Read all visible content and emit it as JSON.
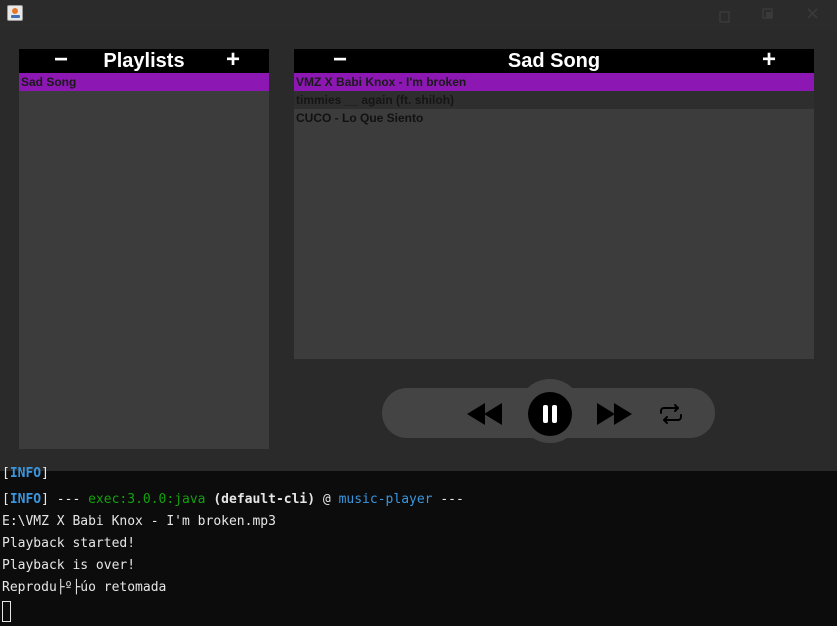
{
  "titlebar": {
    "icon": "java-coffee-icon",
    "controls": [
      "minimize-icon",
      "maximize-icon",
      "close-icon"
    ]
  },
  "playlists_panel": {
    "title": "Playlists",
    "remove_label": "−",
    "add_label": "+",
    "items": [
      {
        "label": "Sad Song",
        "selected": true
      }
    ]
  },
  "songs_panel": {
    "title": "Sad Song",
    "remove_label": "−",
    "add_label": "+",
    "items": [
      {
        "label": "VMZ X Babi Knox - I'm broken",
        "selected": true
      },
      {
        "label": "timmies __ again (ft. shiloh)",
        "selected": false
      },
      {
        "label": "CUCO - Lo Que Siento",
        "selected": false
      }
    ]
  },
  "player_controls": {
    "buttons": [
      "rewind-icon",
      "pause-icon",
      "fast-forward-icon",
      "repeat-icon"
    ]
  },
  "console": {
    "line0": {
      "tag": "INFO"
    },
    "line1": {
      "tag": "INFO",
      "sep1": " --- ",
      "plugin": "exec:3.0.0:java",
      "sp": " ",
      "execution": "(default-cli)",
      "at": " @ ",
      "project": "music-player",
      "sep2": " ---"
    },
    "line2": "E:\\VMZ X Babi Knox - I'm broken.mp3",
    "line3": "Playback started!",
    "line4": "Playback is over!",
    "line5": "Reprodu├º├úo retomada"
  },
  "colors": {
    "selection": "#8c17b3",
    "app_background": "#2a2a2a",
    "list_background": "#3c3c3c",
    "console_info": "#3a96dd",
    "console_plugin": "#13a10e"
  }
}
